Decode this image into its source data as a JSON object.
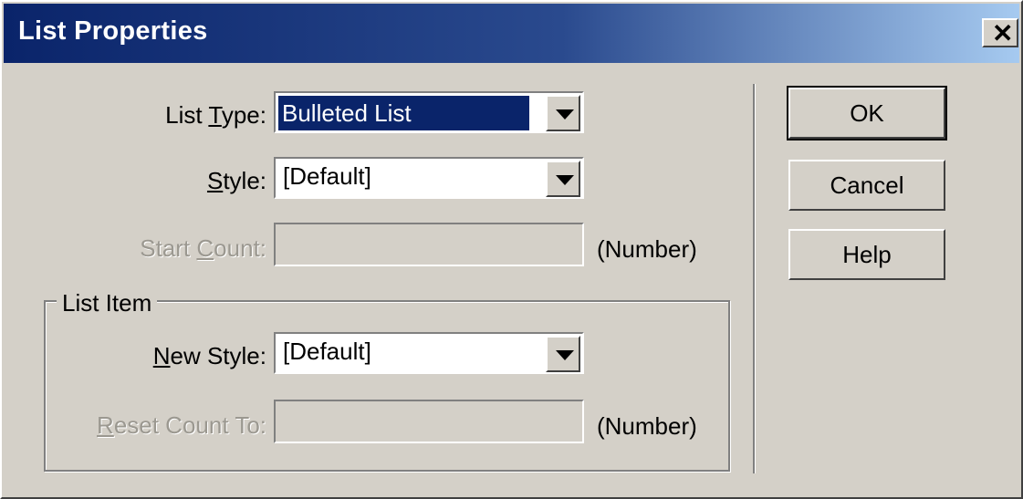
{
  "window": {
    "title": "List Properties",
    "close_glyph": "✕"
  },
  "form": {
    "list_type": {
      "label_pre": "List ",
      "label_key": "T",
      "label_post": "ype:",
      "value": "Bulleted List"
    },
    "style": {
      "label_pre": "",
      "label_key": "S",
      "label_post": "tyle:",
      "value": "[Default]"
    },
    "start_count": {
      "label_pre": "Start ",
      "label_key": "C",
      "label_post": "ount:",
      "value": "",
      "suffix": "(Number)"
    }
  },
  "list_item": {
    "group_title": "List Item",
    "new_style": {
      "label_pre": "",
      "label_key": "N",
      "label_post": "ew Style:",
      "value": "[Default]"
    },
    "reset_count": {
      "label_pre": "",
      "label_key": "R",
      "label_post": "eset Count To:",
      "value": "",
      "suffix": "(Number)"
    }
  },
  "buttons": {
    "ok": "OK",
    "cancel": "Cancel",
    "help": "Help"
  },
  "colors": {
    "title_start": "#0a246a",
    "title_end": "#a6caf0",
    "face": "#d4d0c8",
    "selection": "#0a246a"
  },
  "icons": [
    "close-icon",
    "dropdown-arrow-icon"
  ]
}
